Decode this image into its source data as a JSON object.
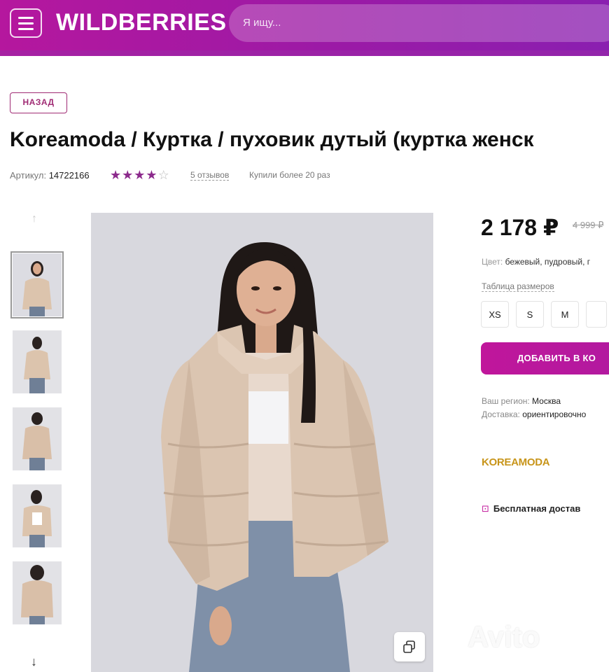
{
  "header": {
    "logo": "WILDBERRIES",
    "search_placeholder": "Я ищу..."
  },
  "page": {
    "back_label": "НАЗАД",
    "title": "Koreamoda / Куртка / пуховик дутый (куртка женск",
    "sku_label": "Артикул:",
    "sku_value": "14722166",
    "rating": 4,
    "reviews": "5 отзывов",
    "bought": "Купили более 20 раз"
  },
  "gallery": {
    "thumb_count": 5,
    "active_index": 0
  },
  "buy": {
    "price": "2 178 ₽",
    "old_price": "4 999 ₽",
    "color_label": "Цвет:",
    "color_value": "бежевый, пудровый, г",
    "size_table_link": "Таблица размеров",
    "sizes": [
      "XS",
      "S",
      "M"
    ],
    "add_to_cart": "ДОБАВИТЬ В КО",
    "region_label": "Ваш регион:",
    "region_value": "Москва",
    "delivery_label": "Доставка:",
    "delivery_value": "ориентировочно",
    "brand": "KOREAMODA",
    "free_shipping": "Бесплатная достав"
  },
  "watermark": "Avito",
  "colors": {
    "brand_purple": "#b5179e",
    "accent": "#a02b74"
  }
}
